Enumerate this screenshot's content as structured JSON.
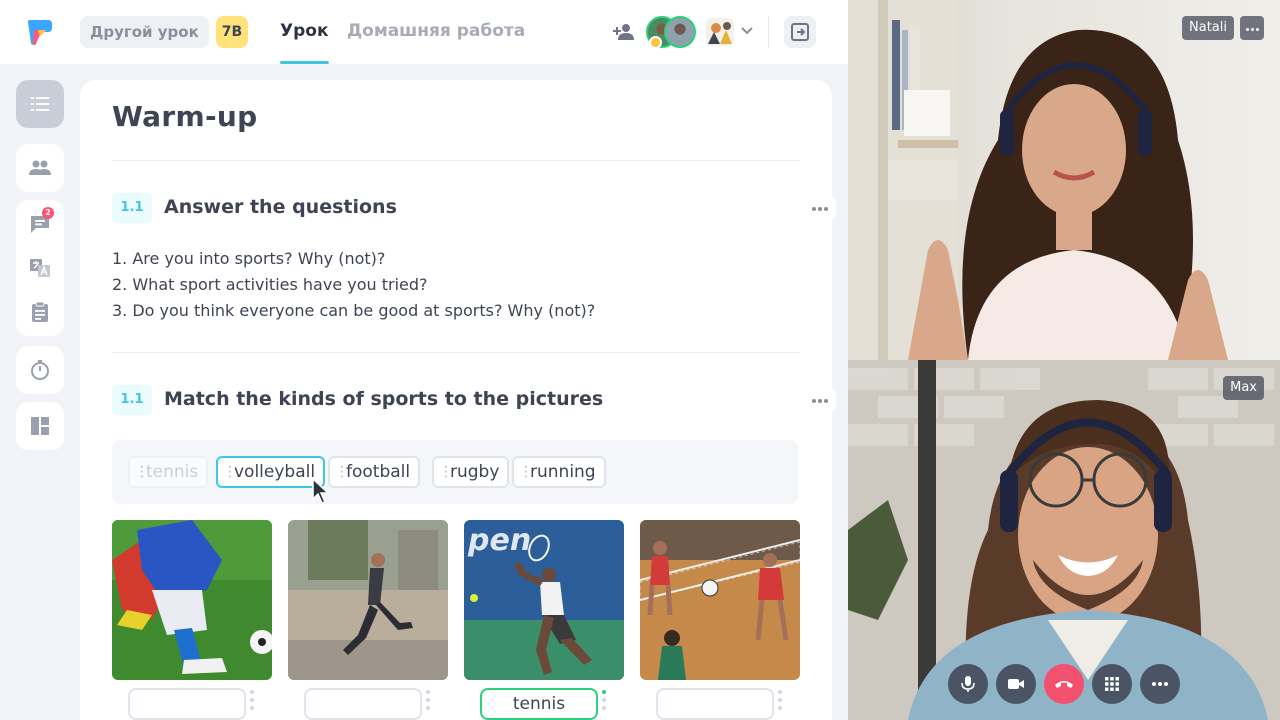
{
  "header": {
    "other_lesson": "Другой урок",
    "class_badge": "7B",
    "tabs": [
      {
        "label": "Урок",
        "active": true
      },
      {
        "label": "Домашняя работа",
        "active": false
      }
    ]
  },
  "lesson": {
    "title": "Warm-up",
    "sections": [
      {
        "number": "1.1",
        "title": "Answer the questions",
        "questions": [
          "1. Are you into sports? Why (not)?",
          "2. What sport activities have you tried?",
          "3. Do you think everyone can be good at sports? Why (not)?"
        ]
      },
      {
        "number": "1.1",
        "title": "Match the kinds of sports to the pictures",
        "word_bank": [
          "tennis",
          "volleyball",
          "football",
          "rugby",
          "running"
        ],
        "answers": [
          "",
          "",
          "tennis",
          ""
        ]
      }
    ]
  },
  "sidebar": {
    "notification_count": "2"
  },
  "video": {
    "participants": [
      {
        "name": "Natali"
      },
      {
        "name": "Max"
      }
    ]
  },
  "colors": {
    "accent": "#3ec8e0",
    "correct": "#2ad07a",
    "end_call": "#f2506e",
    "badge_yellow": "#ffe27a"
  }
}
